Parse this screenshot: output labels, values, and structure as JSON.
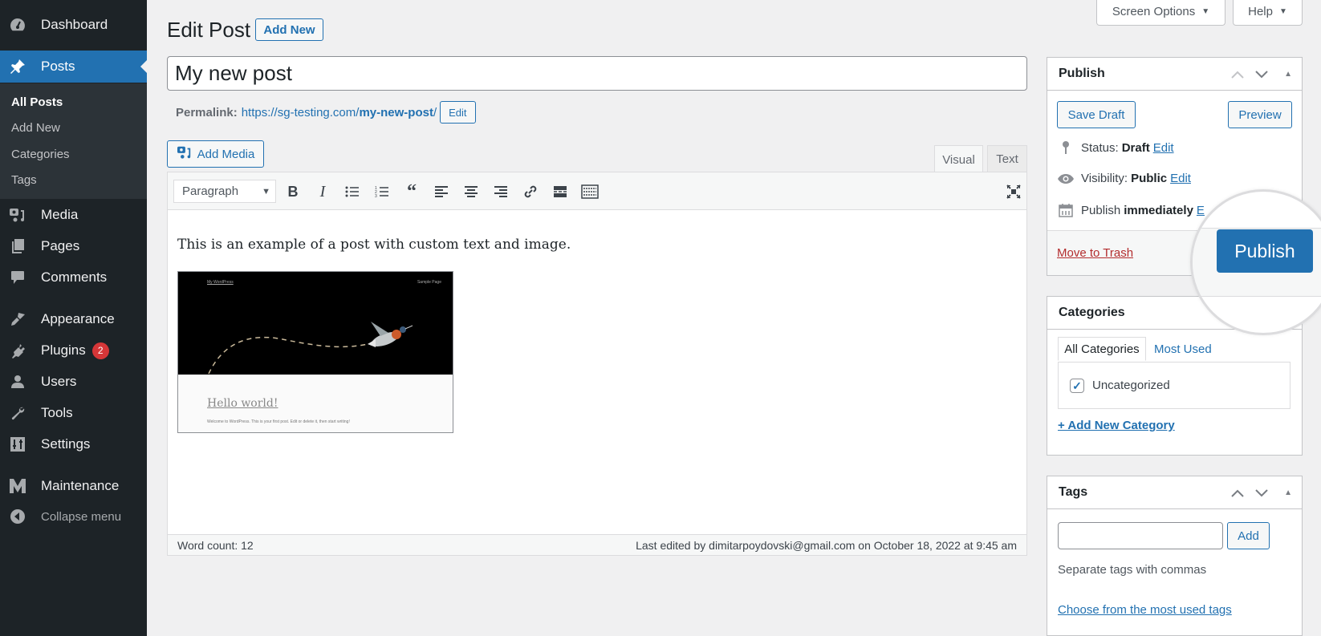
{
  "sidebar": {
    "items": [
      {
        "label": "Dashboard",
        "icon": "dashboard-icon"
      },
      {
        "label": "Posts",
        "icon": "pin-icon",
        "active": true
      },
      {
        "label": "Media",
        "icon": "media-icon"
      },
      {
        "label": "Pages",
        "icon": "pages-icon"
      },
      {
        "label": "Comments",
        "icon": "comment-icon"
      },
      {
        "label": "Appearance",
        "icon": "brush-icon"
      },
      {
        "label": "Plugins",
        "icon": "plug-icon",
        "badge": "2"
      },
      {
        "label": "Users",
        "icon": "user-icon"
      },
      {
        "label": "Tools",
        "icon": "wrench-icon"
      },
      {
        "label": "Settings",
        "icon": "settings-icon"
      },
      {
        "label": "Maintenance",
        "icon": "maintenance-icon"
      }
    ],
    "submenu": [
      "All Posts",
      "Add New",
      "Categories",
      "Tags"
    ],
    "collapse_label": "Collapse menu"
  },
  "header": {
    "screen_options": "Screen Options",
    "help": "Help",
    "title": "Edit Post",
    "add_new": "Add New"
  },
  "post": {
    "title": "My new post",
    "permalink_label": "Permalink:",
    "permalink_base": "https://sg-testing.com/",
    "permalink_slug": "my-new-post",
    "permalink_tail": "/",
    "permalink_edit": "Edit"
  },
  "editor": {
    "add_media": "Add Media",
    "tabs": {
      "visual": "Visual",
      "text": "Text"
    },
    "format": "Paragraph",
    "content_text": "This is an example of a post with custom text and image.",
    "image": {
      "site_name": "My WordPress",
      "nav": "Sample Page",
      "heading": "Hello world!",
      "body": "Welcome to WordPress. This is your first post. Edit or delete it, then start writing!"
    },
    "word_count": "Word count: 12",
    "last_edited": "Last edited by dimitarpoydovski@gmail.com on October 18, 2022 at 9:45 am"
  },
  "publish": {
    "title": "Publish",
    "save_draft": "Save Draft",
    "preview": "Preview",
    "status_label": "Status:",
    "status_value": "Draft",
    "visibility_label": "Visibility:",
    "visibility_value": "Public",
    "schedule_label": "Publish",
    "schedule_value": "immediately",
    "edit": "Edit",
    "edit_truncated": "E",
    "trash": "Move to Trash",
    "publish_button": "Publish"
  },
  "categories": {
    "title": "Categories",
    "tab_all": "All Categories",
    "tab_used": "Most Used",
    "items": [
      {
        "label": "Uncategorized",
        "checked": true
      }
    ],
    "add_new": "+ Add New Category"
  },
  "tags": {
    "title": "Tags",
    "input_value": "",
    "add": "Add",
    "hint": "Separate tags with commas",
    "choose": "Choose from the most used tags"
  },
  "colors": {
    "accent": "#2271b1",
    "sidebar_bg": "#1d2327",
    "submenu_bg": "#2c3338",
    "danger": "#b32d2e",
    "badge": "#d63638"
  }
}
